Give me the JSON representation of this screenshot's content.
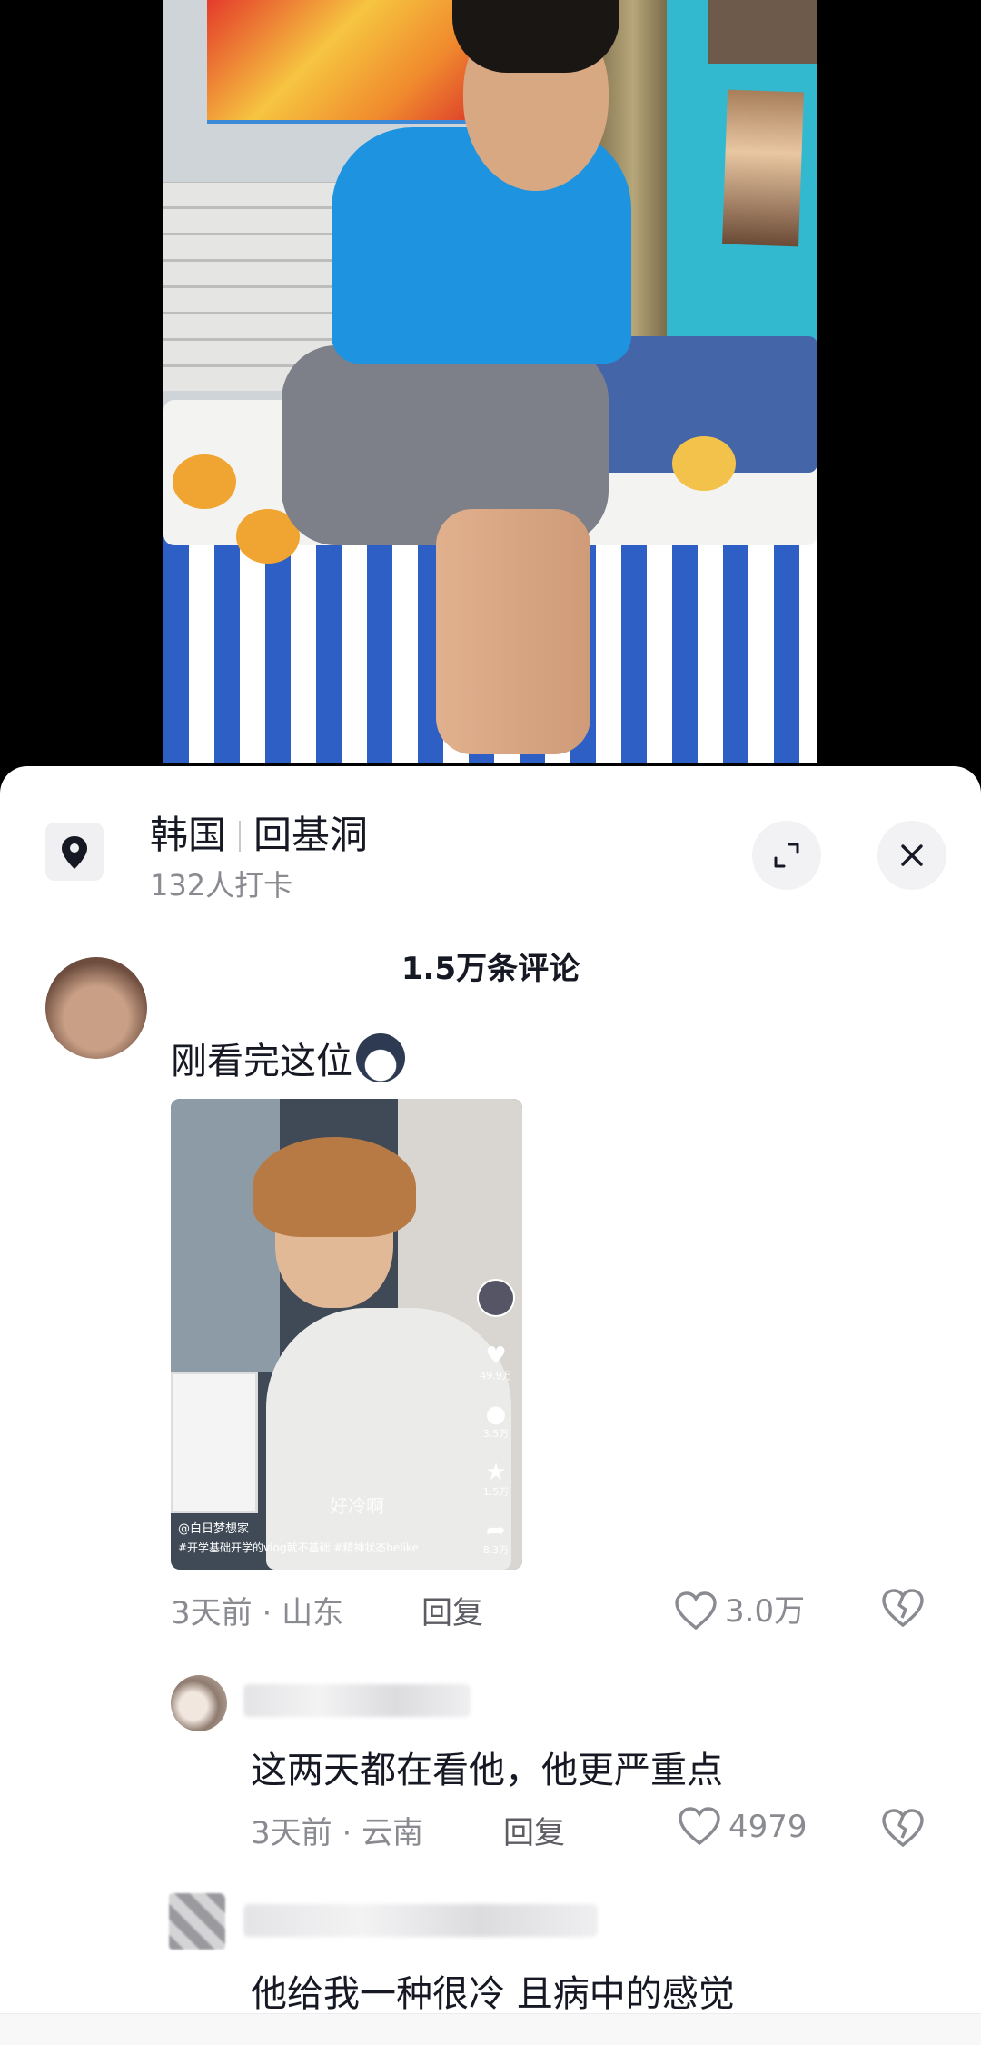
{
  "location": {
    "country": "韩国",
    "place": "回基洞",
    "checkins": "132人打卡"
  },
  "comments_header": "1.5万条评论",
  "main_comment": {
    "text": "刚看完这位",
    "time": "3天前",
    "region": "山东",
    "reply_label": "回复",
    "likes": "3.0万",
    "embedded_video": {
      "author": "@白日梦想家",
      "hashtags": "#开学基础开学的vlog就不基础 #精神状态belike",
      "overlay_text": "好冷啊",
      "likes": "49.9万",
      "comments": "3.5万",
      "favorites": "1.5万",
      "shares": "8.3万"
    }
  },
  "replies": [
    {
      "text": "这两天都在看他，他更严重点",
      "time": "3天前",
      "region": "云南",
      "reply_label": "回复",
      "likes": "4979"
    },
    {
      "text": "他给我一种很冷 且病中的感觉"
    }
  ],
  "meta_separator": "·",
  "icons": {
    "location": "location-pin-icon",
    "expand": "expand-icon",
    "close": "close-icon",
    "like": "heart-icon",
    "dislike": "broken-heart-icon"
  }
}
